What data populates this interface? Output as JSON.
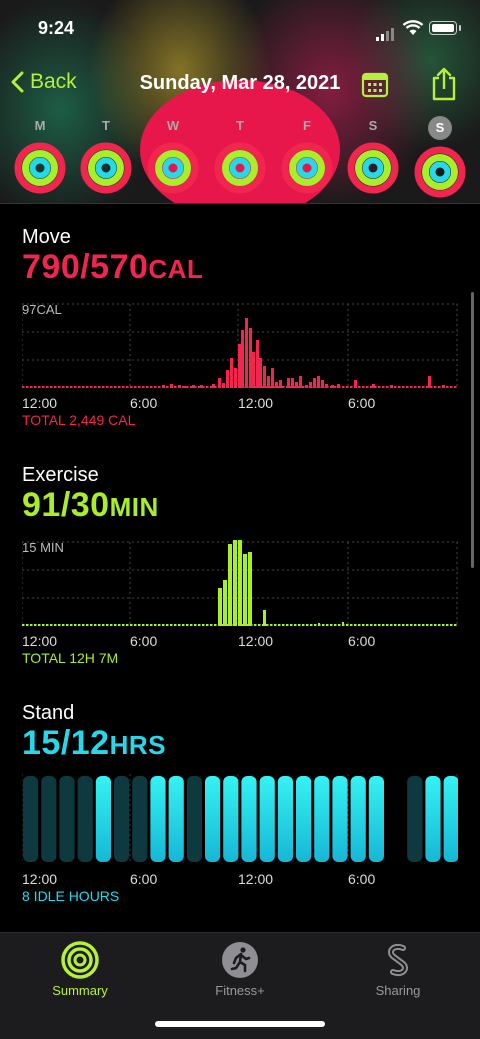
{
  "status_bar": {
    "time": "9:24"
  },
  "nav": {
    "back_label": "Back",
    "title": "Sunday, Mar 28, 2021"
  },
  "week": [
    {
      "label": "M",
      "selected": false
    },
    {
      "label": "T",
      "selected": false
    },
    {
      "label": "W",
      "selected": false
    },
    {
      "label": "T",
      "selected": false
    },
    {
      "label": "F",
      "selected": false
    },
    {
      "label": "S",
      "selected": false
    },
    {
      "label": "S",
      "selected": true
    }
  ],
  "move": {
    "title": "Move",
    "value": "790/570",
    "unit": "CAL",
    "max_label": "97CAL",
    "ticks": [
      "12:00",
      "6:00",
      "12:00",
      "6:00"
    ],
    "total": "TOTAL 2,449 CAL",
    "color": "#f0264f"
  },
  "exercise": {
    "title": "Exercise",
    "value": "91/30",
    "unit": "MIN",
    "max_label": "15 MIN",
    "ticks": [
      "12:00",
      "6:00",
      "12:00",
      "6:00"
    ],
    "total": "TOTAL 12H 7M",
    "color": "#a8ee2a"
  },
  "stand": {
    "title": "Stand",
    "value": "15/12",
    "unit": "HRS",
    "ticks": [
      "12:00",
      "6:00",
      "12:00",
      "6:00"
    ],
    "idle": "8 IDLE HOURS",
    "color": "#27d8ea"
  },
  "tabs": [
    {
      "label": "Summary",
      "icon": "rings-icon",
      "active": true
    },
    {
      "label": "Fitness+",
      "icon": "runner-icon",
      "active": false
    },
    {
      "label": "Sharing",
      "icon": "sharing-icon",
      "active": false
    }
  ],
  "colors": {
    "accent": "#b6f03a",
    "move": "#f0264f",
    "exercise": "#a8ee2a",
    "stand": "#27d8ea"
  }
}
